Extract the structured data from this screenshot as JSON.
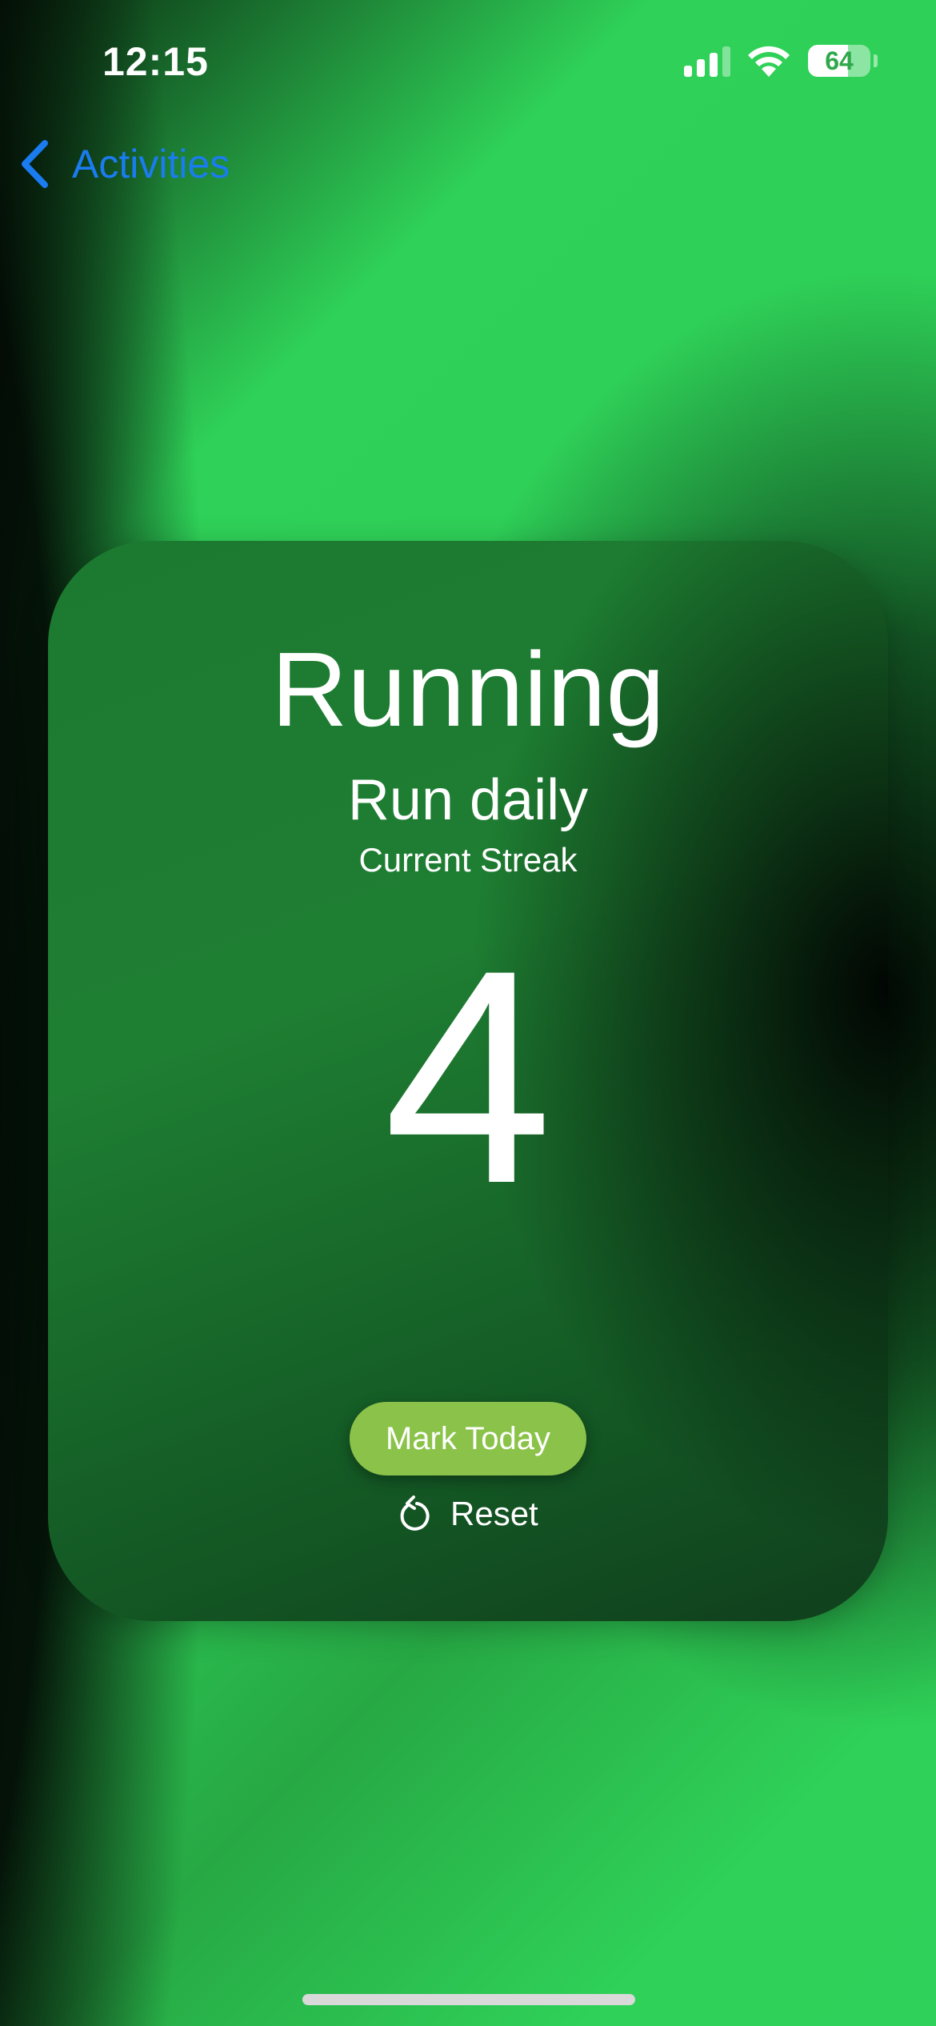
{
  "status_bar": {
    "time": "12:15",
    "battery_percent": "64",
    "battery_level": 0.64,
    "signal_bars_active": 3,
    "signal_bars_total": 4
  },
  "nav": {
    "back_label": "Activities",
    "back_icon": "chevron-left-icon",
    "accent_color": "#1a7cf0"
  },
  "activity": {
    "title": "Running",
    "goal": "Run daily",
    "streak_label": "Current Streak",
    "streak_count": "4"
  },
  "actions": {
    "mark_today_label": "Mark Today",
    "mark_today_color": "#8bc34a",
    "reset_label": "Reset",
    "reset_icon": "reset-arrow-icon"
  },
  "theme": {
    "background_green": "#2fd158",
    "card_green": "#1c7a30"
  }
}
